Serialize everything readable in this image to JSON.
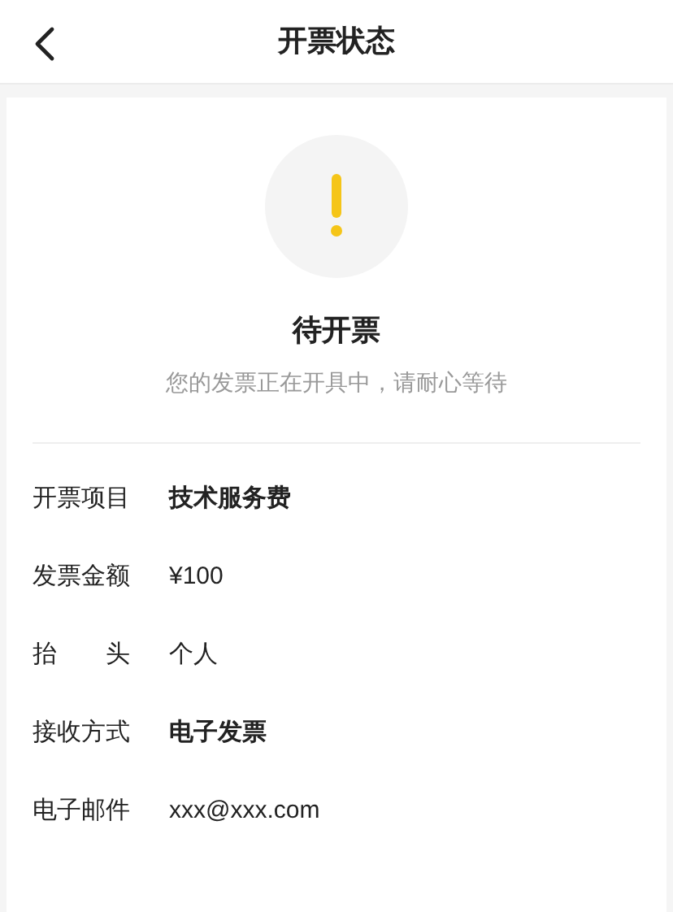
{
  "header": {
    "title": "开票状态"
  },
  "status": {
    "title": "待开票",
    "subtitle": "您的发票正在开具中，请耐心等待"
  },
  "details": [
    {
      "label": "开票项目",
      "value": "技术服务费",
      "bold": true
    },
    {
      "label": "发票金额",
      "value": "¥100",
      "bold": false
    },
    {
      "label": "抬　　头",
      "value": "个人",
      "bold": false
    },
    {
      "label": "接收方式",
      "value": "电子发票",
      "bold": true
    },
    {
      "label": "电子邮件",
      "value": "xxx@xxx.com",
      "bold": false
    }
  ]
}
